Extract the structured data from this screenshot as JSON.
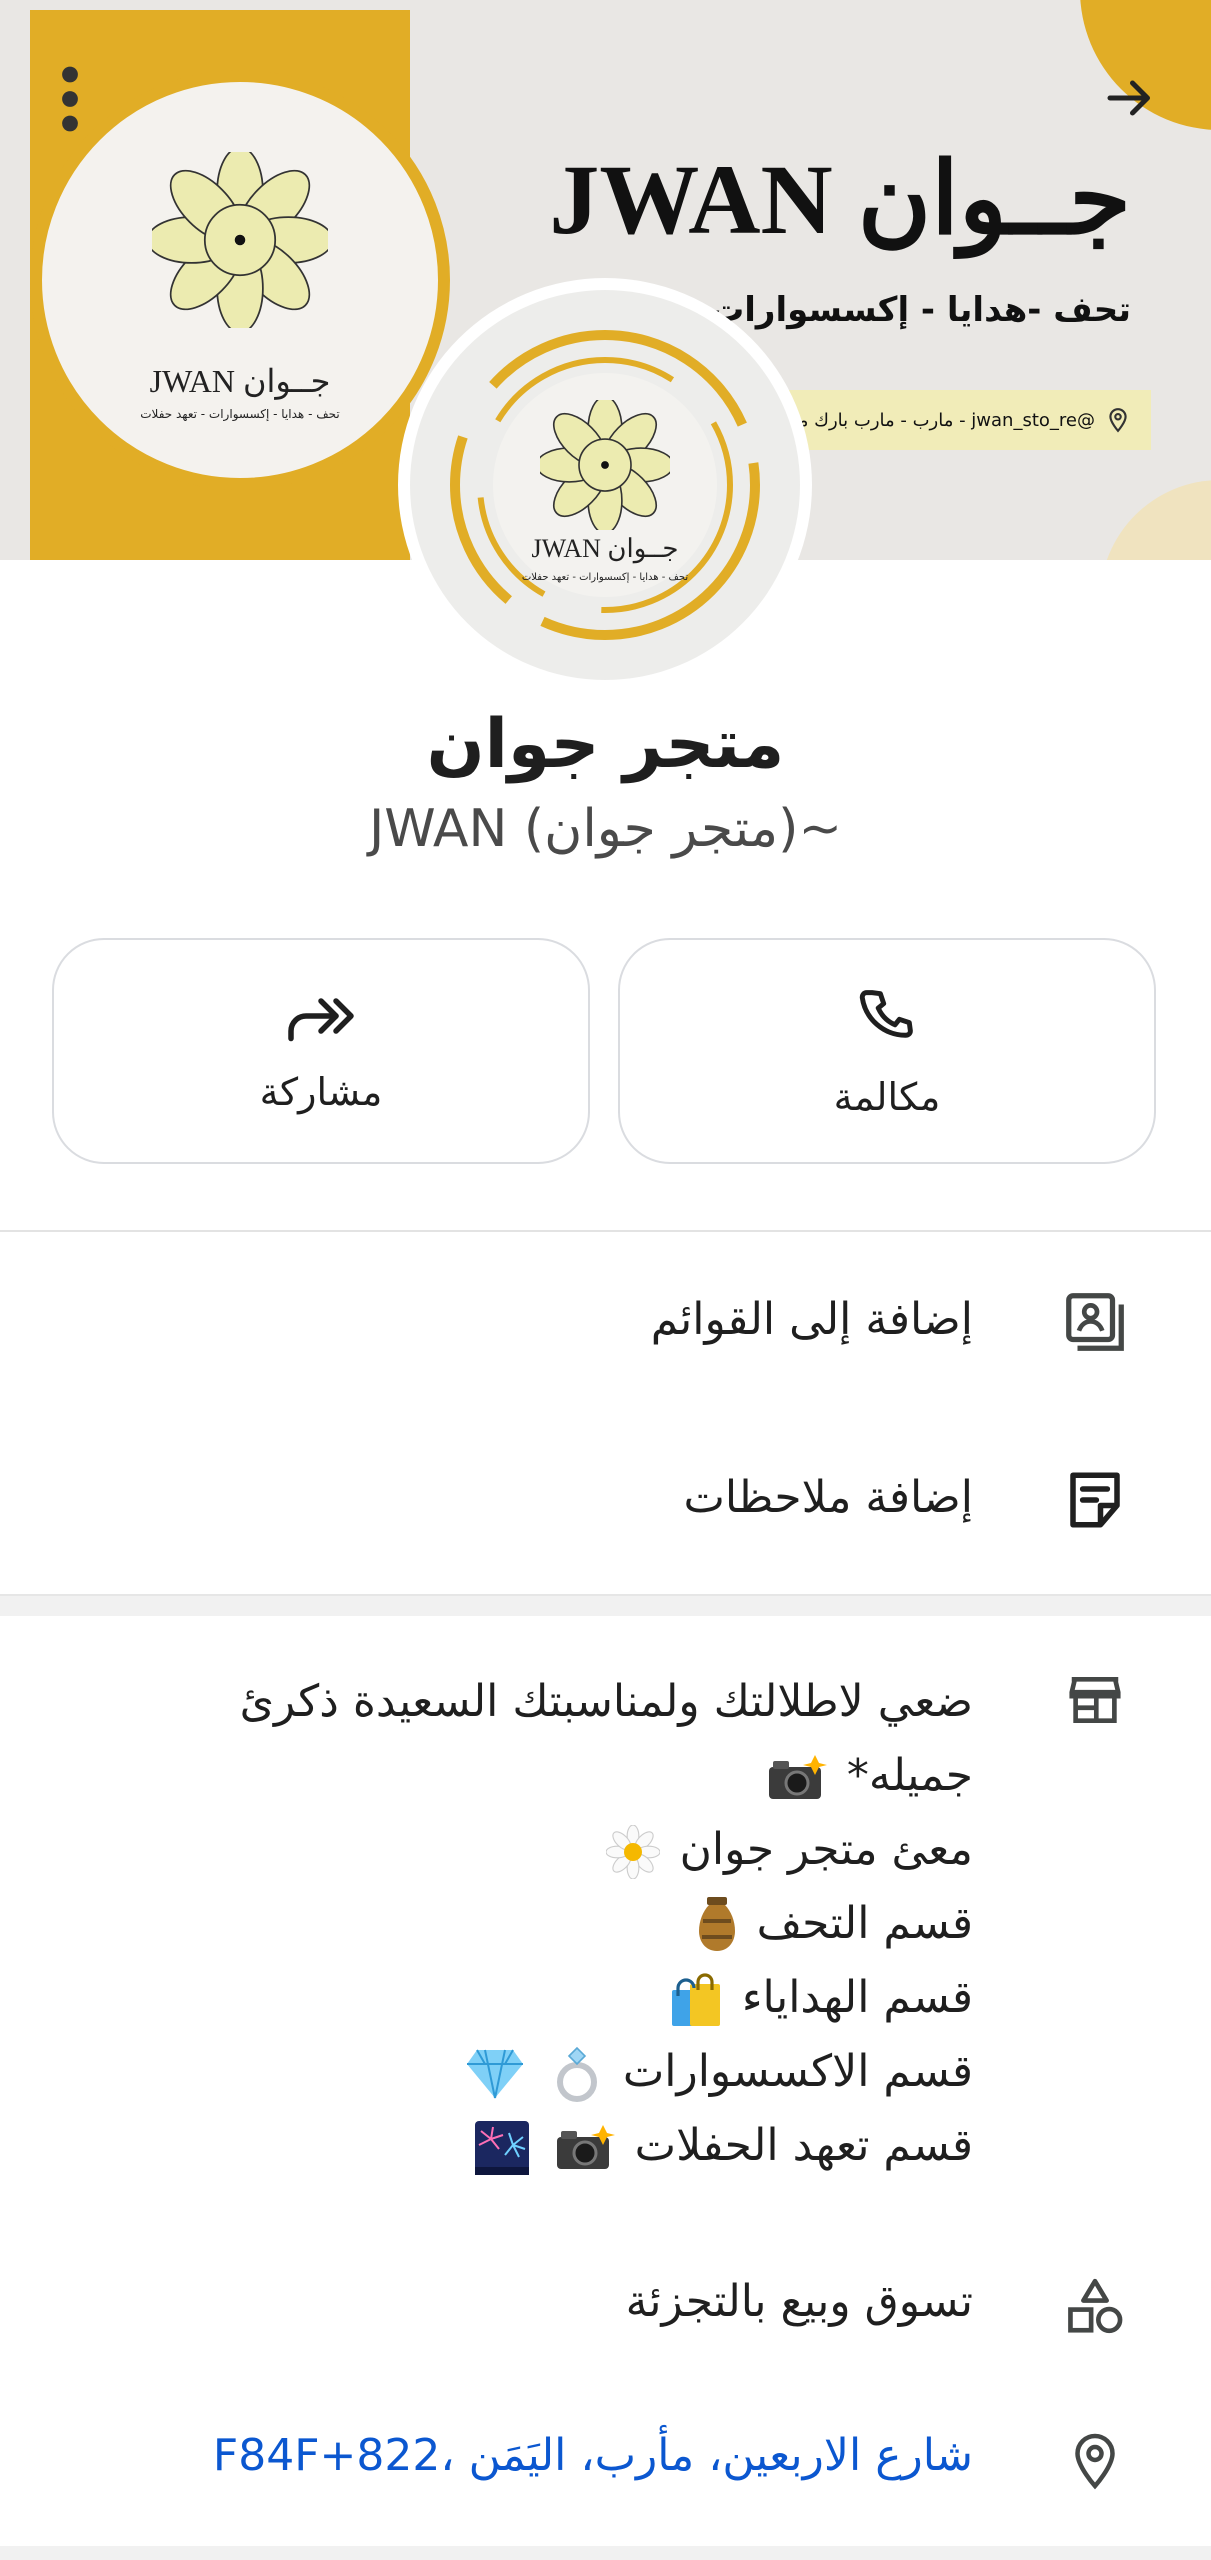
{
  "cover": {
    "brand_latin": "JWAN",
    "brand_arabic": "جــوان",
    "tagline": "تحف -هدايا - إكسسوارات",
    "address_strip": "مارب - مارب بارك مول - jwan_sto_re@",
    "logo_brand": "JWAN جــوان",
    "logo_tagline": "تحف - هدايا - إكسسوارات - تعهد حفلات",
    "colors": {
      "gold": "#e1ad26",
      "cream": "#f1ecb8",
      "flower": "#ecebb0"
    }
  },
  "header": {
    "back_icon": "arrow-forward-icon",
    "menu_icon": "more-vertical-icon"
  },
  "avatar": {
    "logo_brand": "JWAN جــوان",
    "logo_tagline": "تحف - هدايا - إكسسوارات - تعهد حفلات"
  },
  "place": {
    "title": "متجر جوان",
    "subtitle": "JWAN (متجر جوان)~"
  },
  "actions": {
    "call_label": "مكالمة",
    "share_label": "مشاركة"
  },
  "rows": {
    "add_to_lists": "إضافة إلى القوائم",
    "add_notes": "إضافة ملاحظات",
    "category": "تسوق وبيع بالتجزئة",
    "address": "شارع الاربعين، مأرب، اليَمَن ،F84F+822"
  },
  "description": {
    "lines": [
      "ضعي لاطلالتك ولمناسبتك السعيدة ذكرئ",
      "جميله*",
      "معئ متجر جوان",
      "قسم التحف",
      "قسم الهداياء",
      "قسم الاكسسوارات",
      "قسم تعهد الحفلات"
    ]
  },
  "icons": {
    "call": "phone-icon",
    "share": "share-forward-icon",
    "lists": "saved-list-icon",
    "notes": "note-icon",
    "description": "storefront-icon",
    "category": "shapes-icon",
    "address": "location-pin-icon"
  },
  "colors": {
    "link_blue": "#0b57d0",
    "border": "#dadce0",
    "icon": "#444746"
  }
}
